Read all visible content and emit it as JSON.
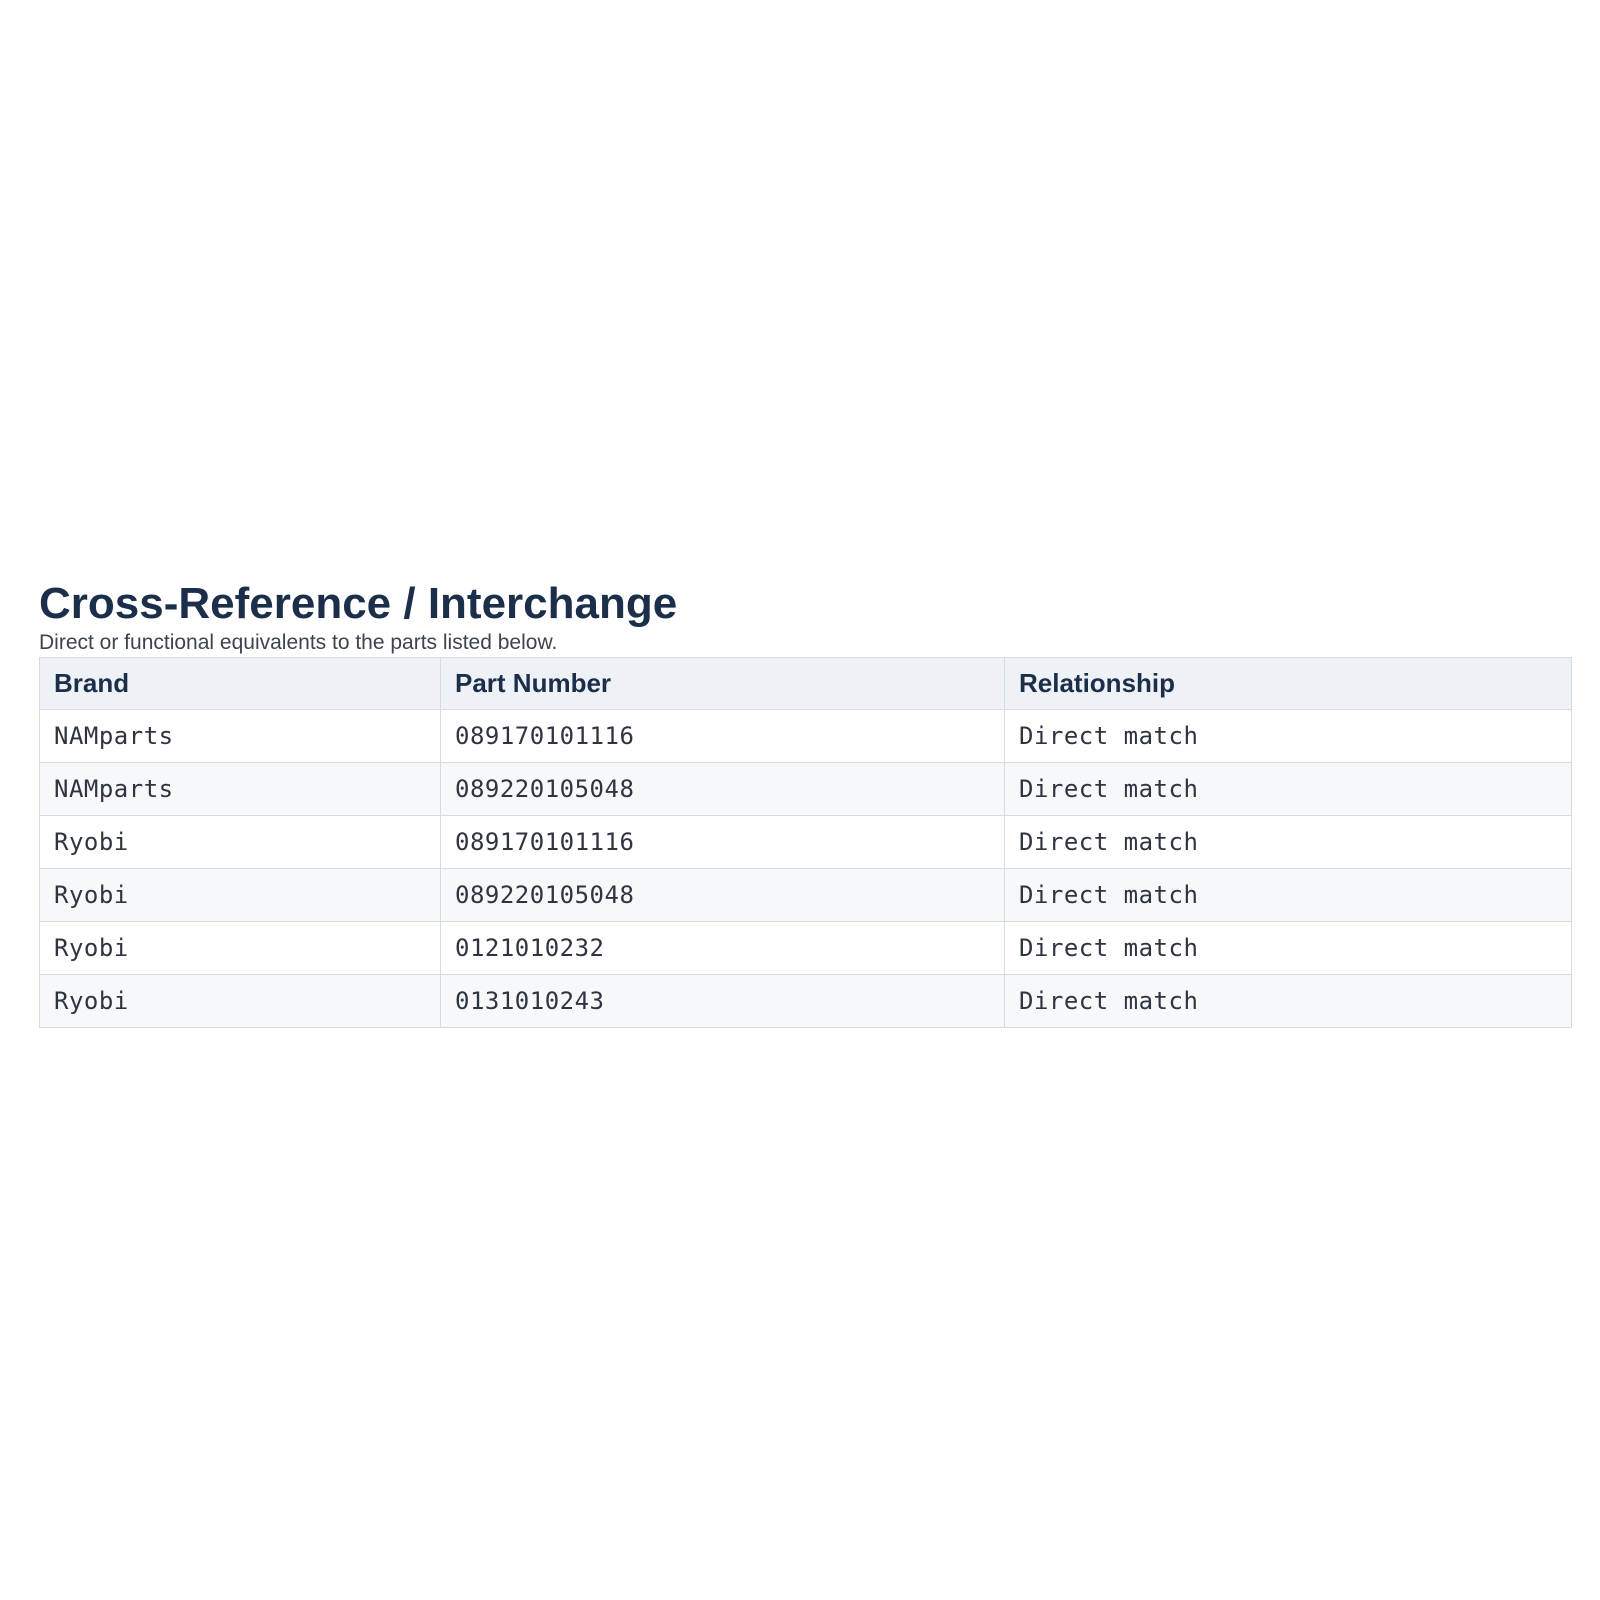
{
  "section": {
    "title": "Cross-Reference / Interchange",
    "subtitle": "Direct or functional equivalents to the parts listed below."
  },
  "table": {
    "headers": {
      "brand": "Brand",
      "part_number": "Part Number",
      "relationship": "Relationship"
    },
    "rows": [
      {
        "brand": "NAMparts",
        "part_number": "089170101116",
        "relationship": "Direct match"
      },
      {
        "brand": "NAMparts",
        "part_number": "089220105048",
        "relationship": "Direct match"
      },
      {
        "brand": "Ryobi",
        "part_number": "089170101116",
        "relationship": "Direct match"
      },
      {
        "brand": "Ryobi",
        "part_number": "089220105048",
        "relationship": "Direct match"
      },
      {
        "brand": "Ryobi",
        "part_number": "0121010232",
        "relationship": "Direct match"
      },
      {
        "brand": "Ryobi",
        "part_number": "0131010243",
        "relationship": "Direct match"
      }
    ]
  }
}
